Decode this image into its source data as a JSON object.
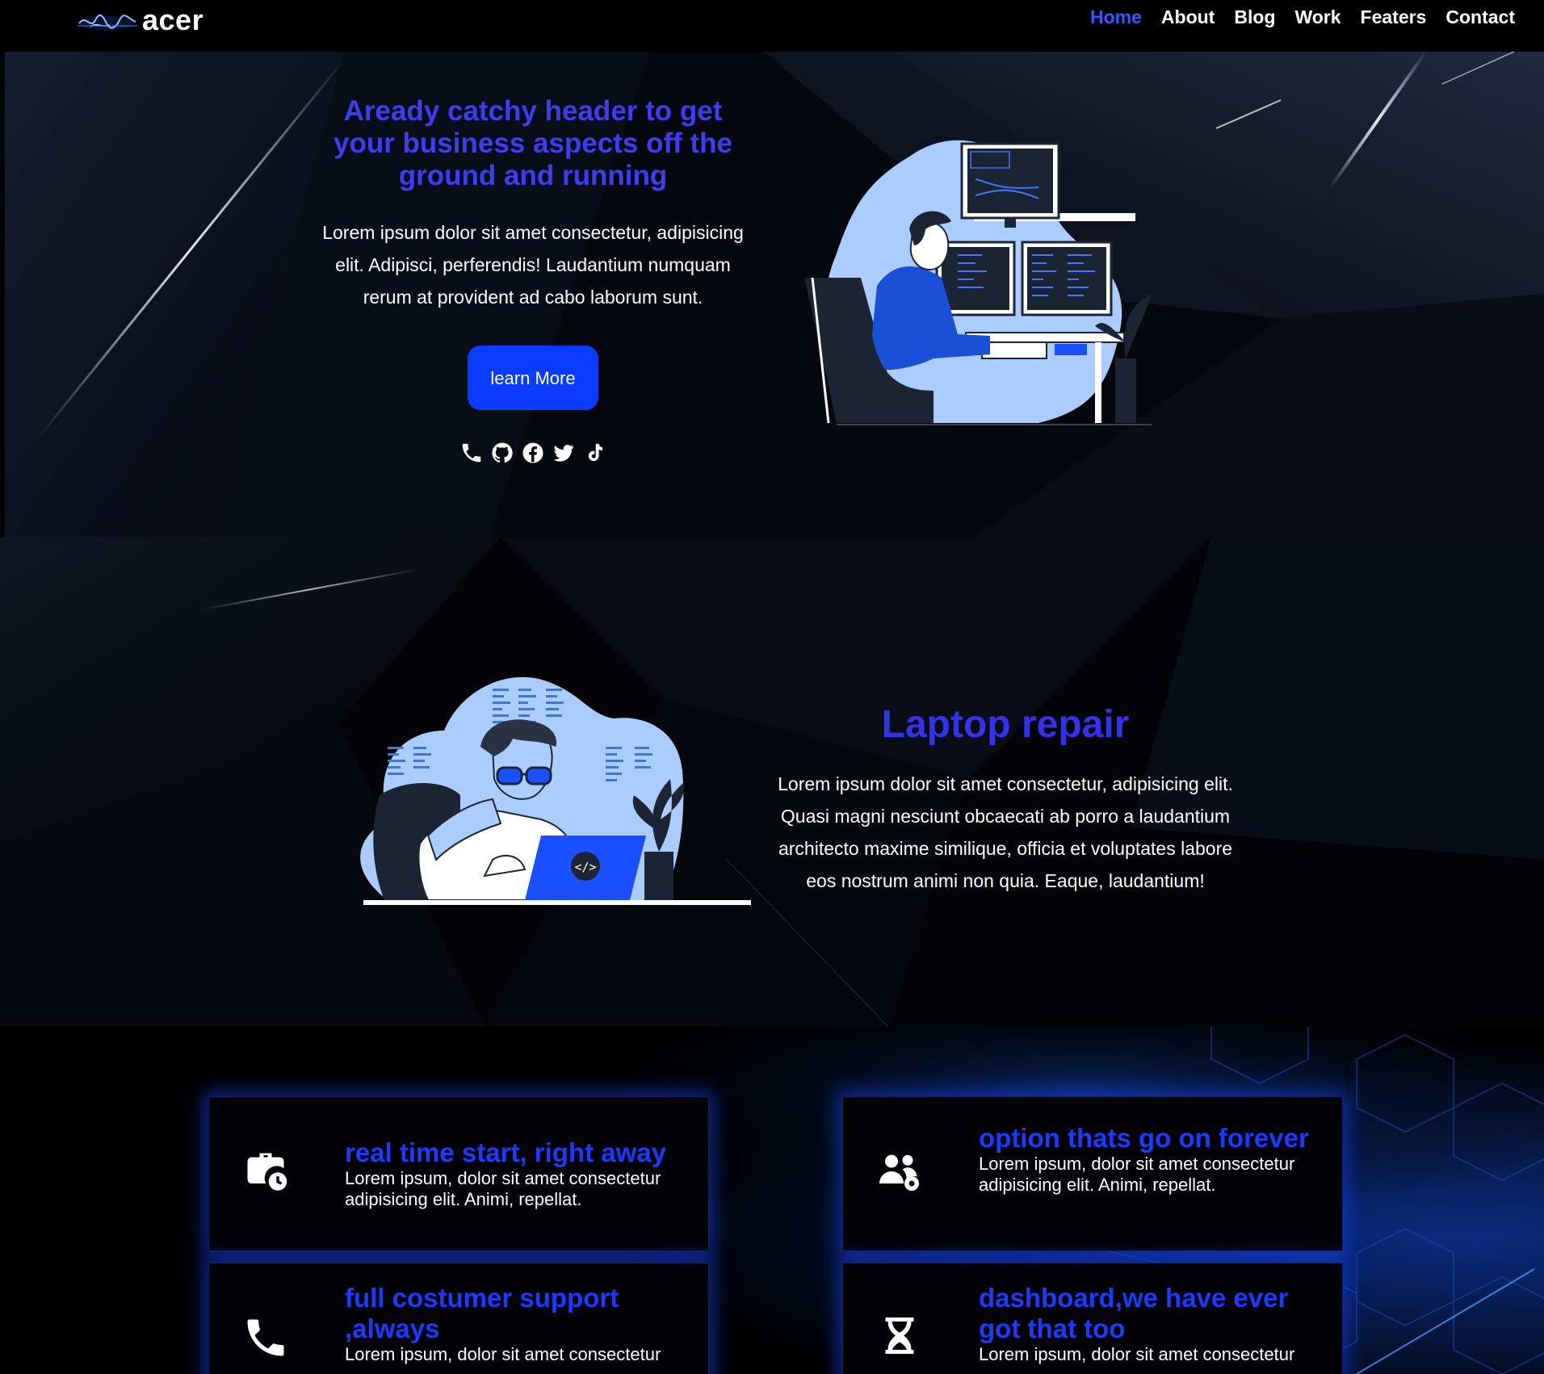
{
  "brand": {
    "name": "acer",
    "logo_icon": "signature-logo"
  },
  "nav": {
    "items": [
      {
        "label": "Home",
        "active": true
      },
      {
        "label": "About",
        "active": false
      },
      {
        "label": "Blog",
        "active": false
      },
      {
        "label": "Work",
        "active": false
      },
      {
        "label": "Featers",
        "active": false
      },
      {
        "label": "Contact",
        "active": false
      }
    ],
    "active_color": "#2f5bff"
  },
  "hero": {
    "title": "Aready catchy header to get your business aspects off the ground and running",
    "description": "Lorem ipsum dolor sit amet consectetur, adipisicing elit. Adipisci, perferendis! Laudantium numquam rerum at provident ad cabo laborum sunt.",
    "button_label": "learn More",
    "socials": [
      "phone-icon",
      "github-icon",
      "facebook-icon",
      "twitter-icon",
      "tiktok-icon"
    ],
    "illustration": "developer-at-desktop-monitors"
  },
  "section2": {
    "title": "Laptop repair",
    "description": "Lorem ipsum dolor sit amet consectetur, adipisicing elit. Quasi magni nesciunt obcaecati ab porro a laudantium architecto maxime similique, officia et voluptates labore eos nostrum animi non quia. Eaque, laudantium!",
    "illustration": "developer-with-laptop"
  },
  "features": {
    "cards": [
      {
        "icon": "briefcase-clock-icon",
        "title": "real time start, right away",
        "text": "Lorem ipsum, dolor sit amet consectetur adipisicing elit. Animi, repellat."
      },
      {
        "icon": "users-gear-icon",
        "title": "option thats go on forever",
        "text": "Lorem ipsum, dolor sit amet consectetur adipisicing elit. Animi, repellat."
      },
      {
        "icon": "phone-icon",
        "title": "full costumer support ,always",
        "text": "Lorem ipsum, dolor sit amet consectetur"
      },
      {
        "icon": "hourglass-icon",
        "title": "dashboard,we have ever got that too",
        "text": "Lorem ipsum, dolor sit amet consectetur"
      }
    ]
  },
  "colors": {
    "accent": "#0a3cff",
    "heading": "#3333ee",
    "card_glow": "#1946ff"
  }
}
